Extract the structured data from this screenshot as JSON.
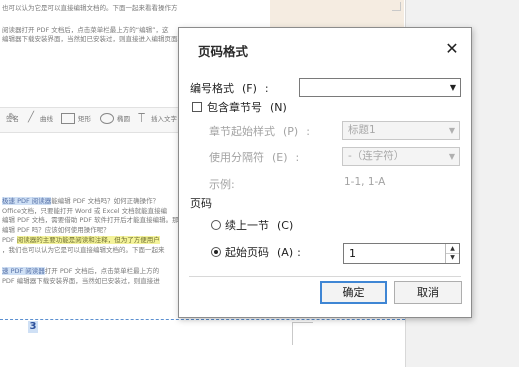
{
  "background": {
    "lines": [
      "也可以认为它是可以直接编辑文档的。下面一起来看看操作方",
      "阅读器打开 PDF 文档后，点击菜单栏最上方的“编辑”，这",
      "编辑器下载安装界面，当然如已安装过，则直接进入编辑页面。"
    ],
    "draw_toolbar": [
      {
        "icon": "pen-icon",
        "label": "签名"
      },
      {
        "icon": "line-icon",
        "label": "曲线"
      },
      {
        "icon": "rectangle-icon",
        "label": "矩形"
      },
      {
        "icon": "ellipse-icon",
        "label": "椭圆"
      },
      {
        "icon": "text-insert-icon",
        "label": "插入文字"
      }
    ],
    "para2": [
      {
        "hl": "极速 PDF 阅读器",
        "rest": "能编辑 PDF 文档吗？如何正确操作？"
      },
      {
        "hl": "",
        "rest": "Office文档，只要能打开 Word 或 Excel 文档就能直接编"
      },
      {
        "hl": "",
        "rest": "编辑 PDF 文档，需要借助 PDF 软件打开后才能直接编辑。那么极速"
      },
      {
        "hl": "",
        "rest": "编辑 PDF 吗？应该如何使用操作呢？"
      },
      {
        "pre": "PDF ",
        "hl": "阅读器的主要功能是阅读和注释，但为了方便用户",
        "rest": ""
      },
      {
        "hl": "",
        "rest": "，我们也可以认为它是可以直接编辑文档的。下面一起来"
      }
    ],
    "para3": [
      {
        "hl": "速 PDF 阅读器",
        "rest": "打开 PDF 文档后，点击菜单栏最上方的"
      },
      {
        "hl": "",
        "rest": "PDF 编辑器下载安装界面，当然如已安装过，则直接进"
      }
    ],
    "page_number": "3"
  },
  "dialog": {
    "title": "页码格式",
    "close_symbol": "✕",
    "number_format": {
      "label": "编号格式",
      "key": "(F)",
      "colon": ":",
      "value": ""
    },
    "include_chapter": {
      "label": "包含章节号",
      "key": "(N)",
      "checked": false
    },
    "chapter_style": {
      "label": "章节起始样式",
      "key": "(P)",
      "colon": ":",
      "value": "标题1"
    },
    "separator": {
      "label": "使用分隔符",
      "key": "(E)",
      "colon": ":",
      "value": "-（连字符）"
    },
    "example": {
      "label": "示例:",
      "value": "1-1, 1-A"
    },
    "page_numbering": {
      "section_label": "页码",
      "continue": {
        "label": "续上一节",
        "key": "(C)",
        "selected": false
      },
      "start_at": {
        "label": "起始页码",
        "key": "(A)",
        "colon": ":",
        "selected": true,
        "value": "1"
      }
    },
    "ok_label": "确定",
    "cancel_label": "取消"
  },
  "colors": {
    "accent": "#3f86d4",
    "highlight_blue": "#cfe0f5",
    "highlight_yellow": "#f4f39a"
  }
}
